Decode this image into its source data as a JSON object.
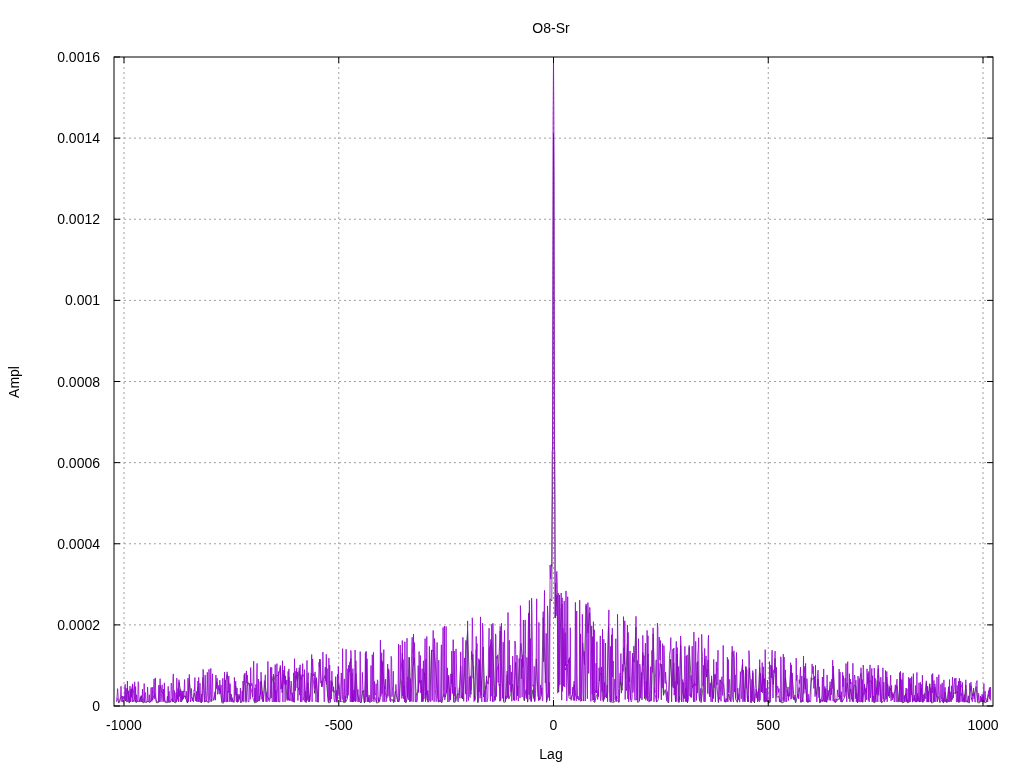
{
  "plot": {
    "title": "O8-Sr",
    "xlabel": "Lag",
    "ylabel": "Ampl",
    "x_tick_labels": [
      "-1000",
      "-500",
      "0",
      "500",
      "1000"
    ],
    "y_tick_labels": [
      "0.0016",
      "0.0014",
      "0.0012",
      "0.001",
      "0.0008",
      "0.0006",
      "0.0004",
      "0.0002",
      "0"
    ]
  }
}
